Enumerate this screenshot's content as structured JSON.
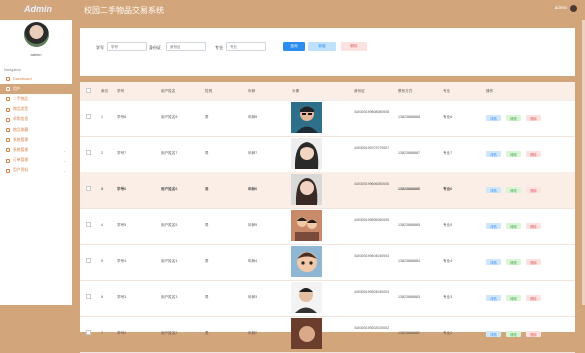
{
  "app": {
    "brand": "Admin",
    "title": "校园二手物品交易系统",
    "top_user": "admin"
  },
  "sidebar": {
    "username": "admin",
    "nav_header": "Navigation",
    "items": [
      {
        "label": "Dashboard",
        "icon": "dashboard-icon",
        "active": false,
        "expandable": false
      },
      {
        "label": "用户",
        "icon": "user-icon",
        "active": true,
        "expandable": false
      },
      {
        "label": "二手物品",
        "icon": "goods-icon",
        "active": false,
        "expandable": false
      },
      {
        "label": "物品类型",
        "icon": "category-icon",
        "active": false,
        "expandable": false
      },
      {
        "label": "求购信息",
        "icon": "request-icon",
        "active": false,
        "expandable": false
      },
      {
        "label": "物品收藏",
        "icon": "favorite-icon",
        "active": false,
        "expandable": false
      },
      {
        "label": "系统管理",
        "icon": "settings-icon",
        "active": false,
        "expandable": false
      },
      {
        "label": "系统管理",
        "icon": "system-icon",
        "active": false,
        "expandable": true
      },
      {
        "label": "订单管理",
        "icon": "order-icon",
        "active": false,
        "expandable": true
      },
      {
        "label": "用户资料",
        "icon": "profile-icon",
        "active": false,
        "expandable": true
      }
    ]
  },
  "search": {
    "fields": [
      {
        "label": "学号",
        "placeholder": "学号"
      },
      {
        "label": "身份证",
        "placeholder": "身份证"
      },
      {
        "label": "专业",
        "placeholder": "专业"
      }
    ],
    "search_label": "查询",
    "add_label": "新增",
    "delete_label": "删除"
  },
  "table": {
    "headers": [
      "索引",
      "学号",
      "用户姓名",
      "性别",
      "年龄",
      "头像",
      "身份证",
      "联系方式",
      "专业",
      "操作"
    ],
    "rows": [
      {
        "index": "1",
        "student_id": "学号8",
        "name": "用户姓名8",
        "gender": "男",
        "age": "年龄8",
        "id_card": "440300199808080008",
        "phone": "13823888888",
        "major": "专业8",
        "photo": "photo-man-glasses"
      },
      {
        "index": "2",
        "student_id": "学号7",
        "name": "用户姓名7",
        "gender": "男",
        "age": "年龄7",
        "id_card": "440300199707070007",
        "phone": "13823888887",
        "major": "专业7",
        "photo": "photo-girl-bangs"
      },
      {
        "index": "3",
        "student_id": "学号6",
        "name": "用户姓名6",
        "gender": "男",
        "age": "年龄6",
        "id_card": "440300199606060006",
        "phone": "13823888886",
        "major": "专业6",
        "photo": "photo-girl-long-hair"
      },
      {
        "index": "4",
        "student_id": "学号5",
        "name": "用户姓名5",
        "gender": "男",
        "age": "年龄5",
        "id_card": "440300199505050005",
        "phone": "13823888885",
        "major": "专业5",
        "photo": "photo-couple"
      },
      {
        "index": "5",
        "student_id": "学号4",
        "name": "用户姓名4",
        "gender": "男",
        "age": "年龄4",
        "id_card": "440300199404040004",
        "phone": "13823888884",
        "major": "专业4",
        "photo": "photo-cartoon-boy"
      },
      {
        "index": "6",
        "student_id": "学号3",
        "name": "用户姓名3",
        "gender": "男",
        "age": "年龄3",
        "id_card": "440300199303030003",
        "phone": "13823888883",
        "major": "专业3",
        "photo": "photo-man-portrait"
      },
      {
        "index": "7",
        "student_id": "学号2",
        "name": "用户姓名2",
        "gender": "男",
        "age": "年龄2",
        "id_card": "440300199202020002",
        "phone": "13823888882",
        "major": "专业2",
        "photo": "photo-partial"
      }
    ],
    "actions": {
      "detail": "详情",
      "edit": "修改",
      "delete": "删除"
    }
  },
  "colors": {
    "accent": "#d3a57a",
    "primary": "#2d8cf0",
    "danger": "#e25b5b",
    "success": "#3aa14b"
  }
}
